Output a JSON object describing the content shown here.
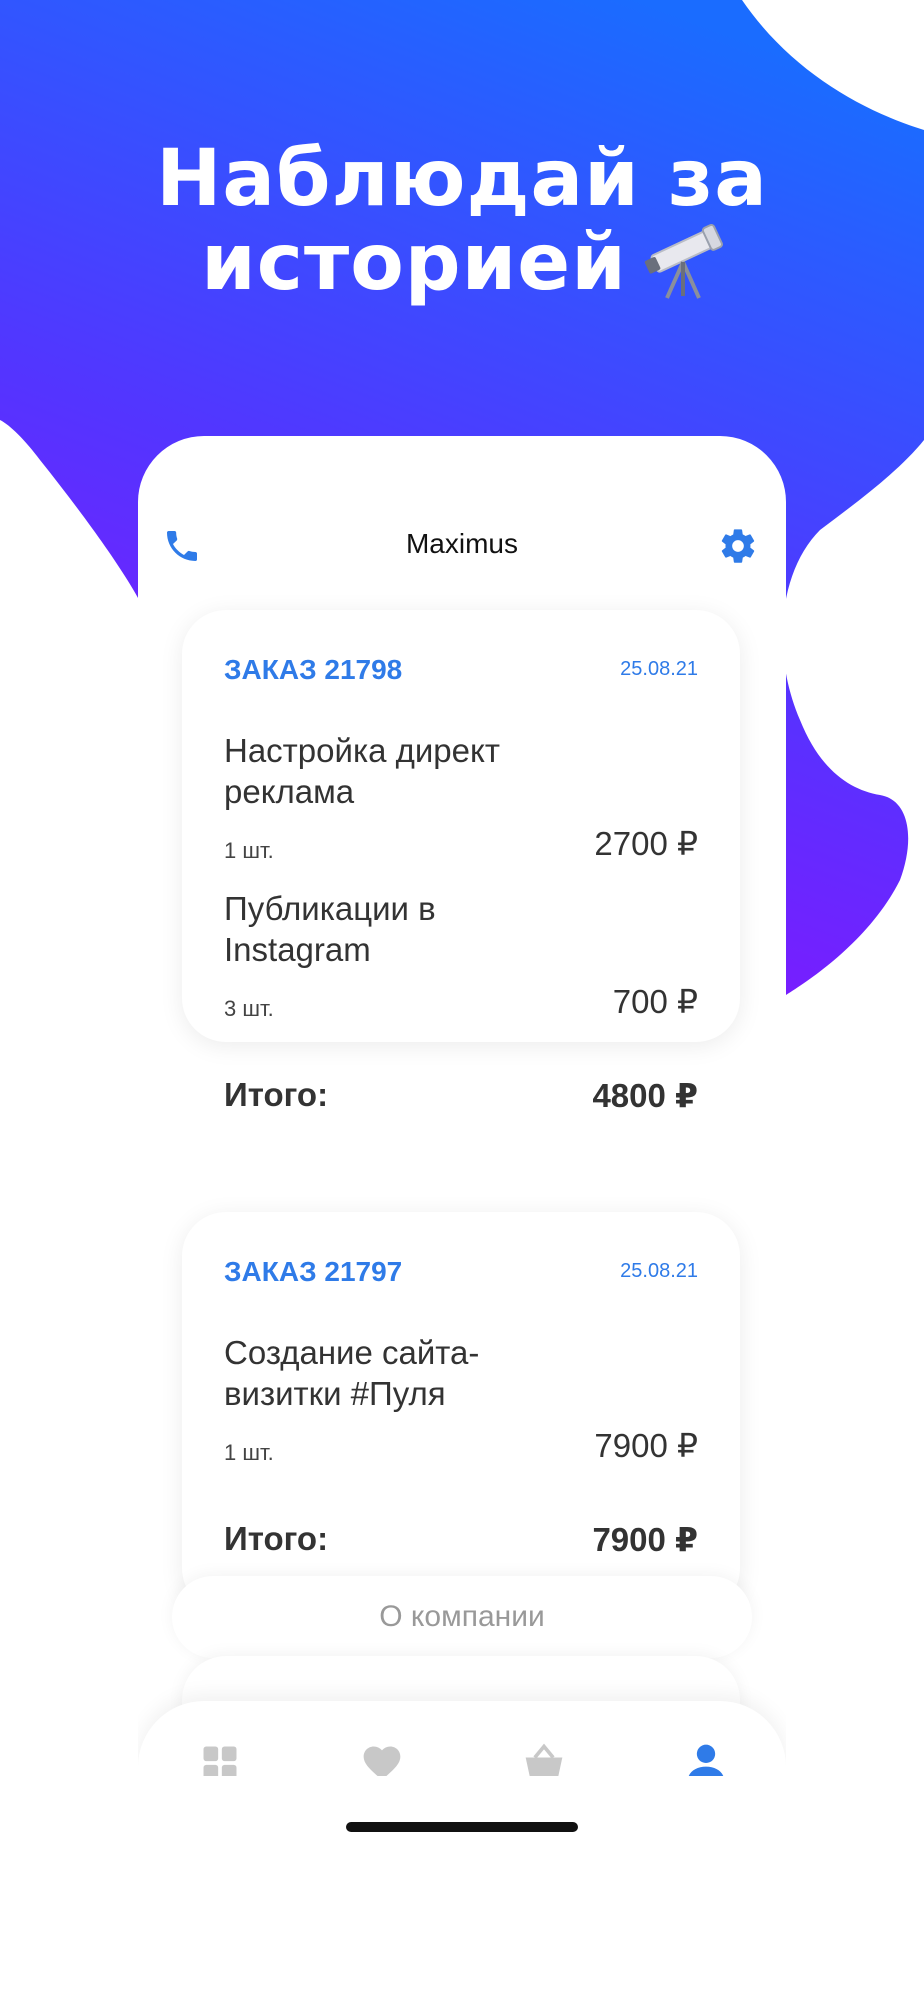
{
  "headline": {
    "line1": "Наблюдай за",
    "line2": "историей"
  },
  "app": {
    "title": "Maximus"
  },
  "orders": [
    {
      "number": "ЗАКАЗ 21798",
      "date": "25.08.21",
      "items": [
        {
          "name": "Настройка директ реклама",
          "qty": "1 шт.",
          "price": "2700 ₽"
        },
        {
          "name": "Публикации в Instagram",
          "qty": "3 шт.",
          "price": "700 ₽"
        }
      ],
      "total_label": "Итого:",
      "total": "4800 ₽"
    },
    {
      "number": "ЗАКАЗ 21797",
      "date": "25.08.21",
      "items": [
        {
          "name": "Создание сайта-визитки #Пуля",
          "qty": "1 шт.",
          "price": "7900 ₽"
        }
      ],
      "total_label": "Итого:",
      "total": "7900 ₽"
    }
  ],
  "about_button": "О компании",
  "tabs": [
    {
      "icon": "grid-icon",
      "active": false
    },
    {
      "icon": "heart-icon",
      "active": false
    },
    {
      "icon": "basket-icon",
      "active": false
    },
    {
      "icon": "profile-icon",
      "active": true
    }
  ],
  "colors": {
    "accent": "#2f7be8",
    "gradient_top": "#1a6cff",
    "gradient_bottom": "#8a12ff",
    "inactive_icon": "#c8c8c8"
  }
}
